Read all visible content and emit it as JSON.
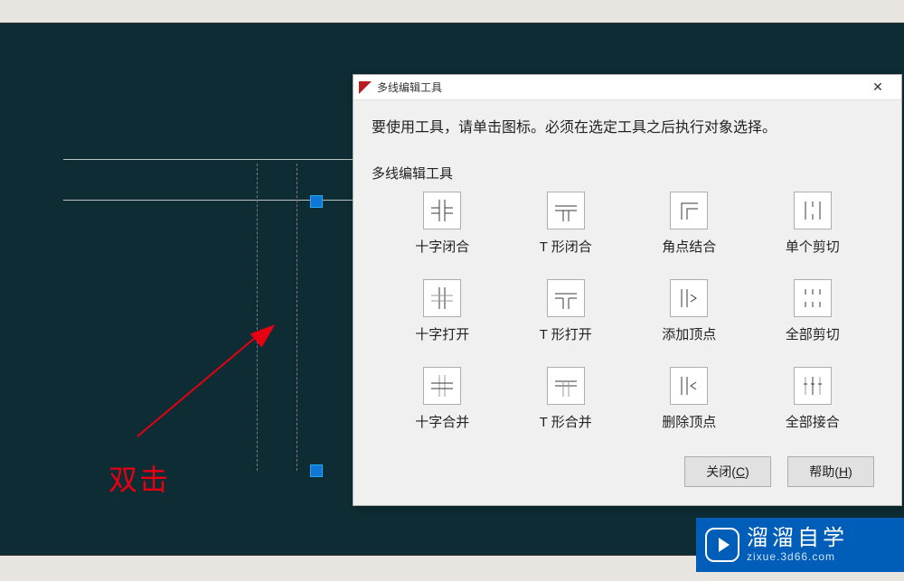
{
  "annotation": {
    "text": "双击"
  },
  "dialog": {
    "title": "多线编辑工具",
    "instruction": "要使用工具，请单击图标。必须在选定工具之后执行对象选择。",
    "section_label": "多线编辑工具",
    "tools": [
      {
        "id": "cross-closed",
        "label": "十字闭合"
      },
      {
        "id": "t-closed",
        "label": "T 形闭合"
      },
      {
        "id": "corner-joint",
        "label": "角点结合"
      },
      {
        "id": "cut-single",
        "label": "单个剪切"
      },
      {
        "id": "cross-open",
        "label": "十字打开"
      },
      {
        "id": "t-open",
        "label": "T 形打开"
      },
      {
        "id": "add-vertex",
        "label": "添加顶点"
      },
      {
        "id": "cut-all",
        "label": "全部剪切"
      },
      {
        "id": "cross-merged",
        "label": "十字合并"
      },
      {
        "id": "t-merged",
        "label": "T 形合并"
      },
      {
        "id": "delete-vertex",
        "label": "删除顶点"
      },
      {
        "id": "weld-all",
        "label": "全部接合"
      }
    ],
    "buttons": {
      "close": {
        "label": "关闭",
        "mnemonic": "C"
      },
      "help": {
        "label": "帮助",
        "mnemonic": "H"
      }
    }
  },
  "watermark": {
    "zh": "溜溜自学",
    "en": "zixue.3d66.com"
  }
}
